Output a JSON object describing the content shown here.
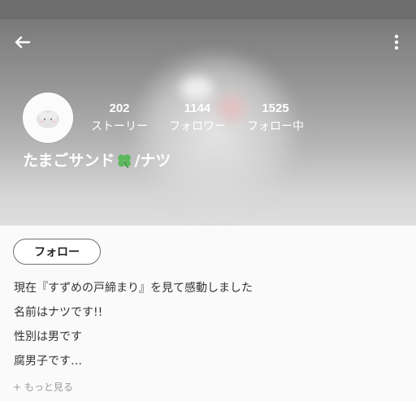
{
  "profile": {
    "display_name": "たまごサンド",
    "name_suffix": "/ナツ",
    "name_emoji_icon": "four-leaf-clover-icon",
    "stats": [
      {
        "count": "202",
        "label": "ストーリー"
      },
      {
        "count": "1144",
        "label": "フォロワー"
      },
      {
        "count": "1525",
        "label": "フォロー中"
      }
    ]
  },
  "actions": {
    "follow_label": "フォロー"
  },
  "bio": {
    "lines": [
      "現在『すずめの戸締まり』を見て感動しました",
      "名前はナツです!!",
      "性別は男です",
      "腐男子です…"
    ],
    "more_label": "+ もっと見る"
  },
  "colors": {
    "header_text": "#ffffff",
    "statusbar": "#6e6e6e",
    "clover_green": "#5cb85c"
  }
}
